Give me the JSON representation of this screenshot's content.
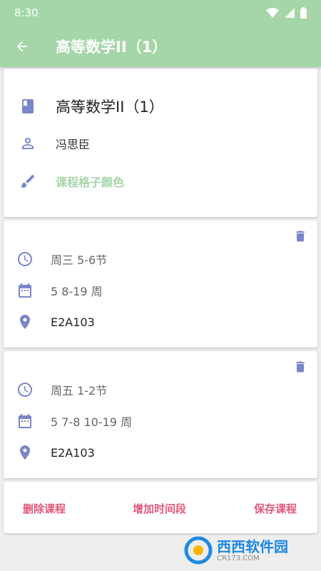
{
  "status": {
    "time": "8:30"
  },
  "appbar": {
    "title": "高等数学II（1）"
  },
  "course": {
    "name": "高等数学II（1）",
    "teacher": "冯思臣",
    "color_label": "课程格子颜色"
  },
  "slots": [
    {
      "day": "周三 5-6节",
      "weeks": "5 8-19 周",
      "room": "E2A103"
    },
    {
      "day": "周五 1-2节",
      "weeks": "5 7-8 10-19 周",
      "room": "E2A103"
    }
  ],
  "actions": {
    "delete": "删除课程",
    "add": "增加时间段",
    "save": "保存课程"
  },
  "watermark": {
    "brand": "西西软件园",
    "site": "CR173.COM"
  },
  "colors": {
    "accent": "#a5d6a7",
    "icon": "#7986cb",
    "action": "#e0597b"
  }
}
